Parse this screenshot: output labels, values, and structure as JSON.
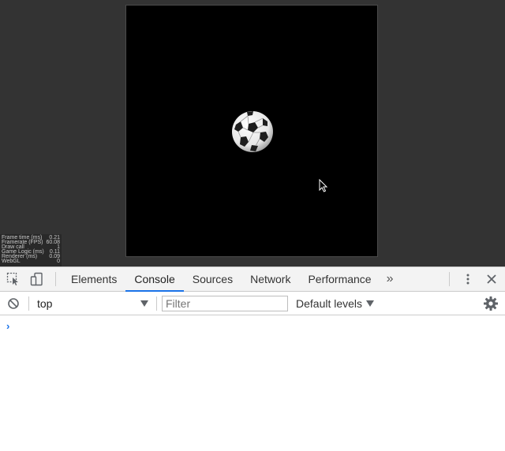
{
  "stats": [
    {
      "label": "Frame time (ms)",
      "value": "0.21"
    },
    {
      "label": "Framerate (FPS)",
      "value": "60.08"
    },
    {
      "label": "Draw call",
      "value": "1"
    },
    {
      "label": "Game Logic (ms)",
      "value": "0.11"
    },
    {
      "label": "Renderer (ms)",
      "value": "0.09"
    },
    {
      "label": "WebGL",
      "value": "0"
    }
  ],
  "devtools": {
    "tabs": [
      "Elements",
      "Console",
      "Sources",
      "Network",
      "Performance"
    ],
    "active_tab": "Console",
    "more_tabs": "»"
  },
  "console": {
    "context": "top",
    "filter_placeholder": "Filter",
    "levels": "Default levels",
    "prompt": "›"
  },
  "icons": {
    "inspect": "inspect-element-icon",
    "device": "device-toolbar-icon",
    "menu": "kebab-menu-icon",
    "close": "close-icon",
    "clear": "clear-console-icon",
    "settings": "gear-icon"
  },
  "colors": {
    "accent": "#1a73e8",
    "canvas": "#000000",
    "page_bg": "#333333"
  }
}
